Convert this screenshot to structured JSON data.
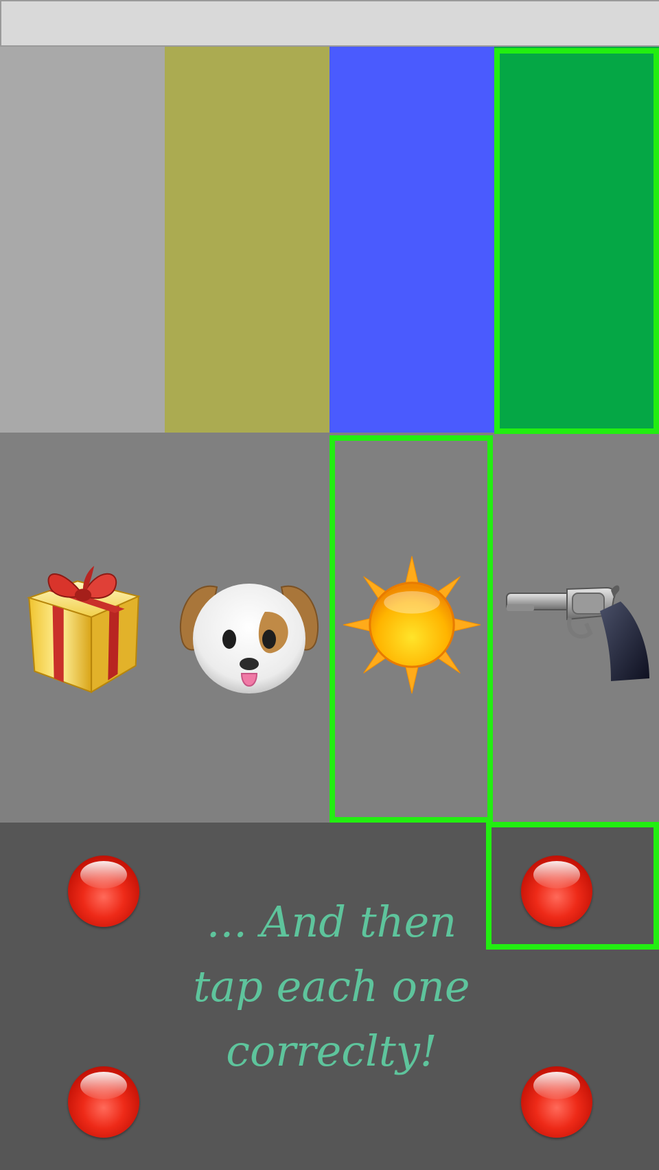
{
  "colors": {
    "swatch_gray": "#a9a9a9",
    "swatch_olive": "#abab51",
    "swatch_blue": "#4a5bfe",
    "swatch_green": "#05a745",
    "highlight": "#22ee11",
    "symbol_row_bg": "#808080",
    "button_area_bg": "#565656",
    "instruction_text": "#5ec49c",
    "button_red": "#ee2a18"
  },
  "color_row": [
    {
      "id": "gray",
      "color": "#a9a9a9"
    },
    {
      "id": "olive",
      "color": "#abab51"
    },
    {
      "id": "blue",
      "color": "#4a5bfe"
    },
    {
      "id": "green",
      "color": "#05a745",
      "highlighted": true
    }
  ],
  "symbol_row": [
    {
      "icon": "gift-icon"
    },
    {
      "icon": "dog-face-icon"
    },
    {
      "icon": "sun-icon",
      "highlighted": true
    },
    {
      "icon": "pistol-icon"
    }
  ],
  "buttons": [
    {
      "position": "top-left"
    },
    {
      "position": "top-right",
      "highlighted": true
    },
    {
      "position": "bottom-left"
    },
    {
      "position": "bottom-right"
    }
  ],
  "instruction": "... And then\ntap each one\ncorreclty!"
}
